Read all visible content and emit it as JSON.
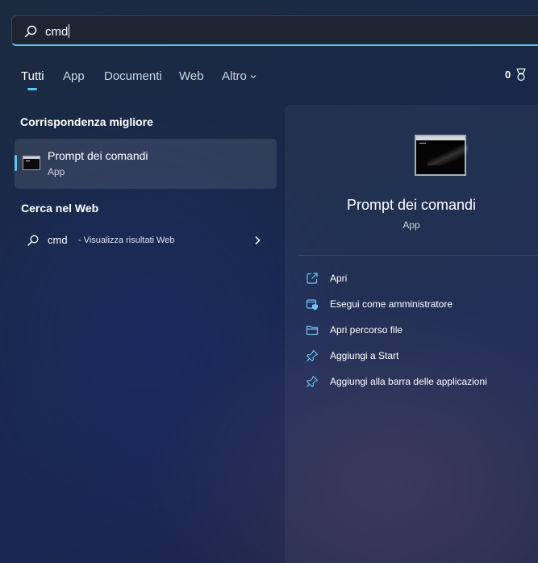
{
  "search": {
    "query": "cmd"
  },
  "tabs": [
    {
      "label": "Tutti",
      "active": true
    },
    {
      "label": "App",
      "active": false
    },
    {
      "label": "Documenti",
      "active": false
    },
    {
      "label": "Web",
      "active": false
    },
    {
      "label": "Altro",
      "active": false,
      "icon": "chevron-down-icon"
    }
  ],
  "rewards": {
    "points": "0",
    "icon": "medal-icon"
  },
  "best_match": {
    "section_title": "Corrispondenza migliore",
    "name": "Prompt dei comandi",
    "type": "App",
    "icon": "command-prompt-icon"
  },
  "web_search": {
    "section_title": "Cerca nel Web",
    "query": "cmd",
    "suffix": "- Visualizza risultati Web",
    "icon": "search-icon"
  },
  "preview": {
    "title": "Prompt dei comandi",
    "subtitle": "App",
    "actions": [
      {
        "label": "Apri",
        "icon": "open-external-icon"
      },
      {
        "label": "Esegui come amministratore",
        "icon": "admin-shield-icon"
      },
      {
        "label": "Apri percorso file",
        "icon": "folder-icon"
      },
      {
        "label": "Aggiungi a Start",
        "icon": "pin-icon"
      },
      {
        "label": "Aggiungi alla barra delle applicazioni",
        "icon": "pin-icon"
      }
    ]
  },
  "colors": {
    "accent": "#5cc4f2",
    "icon_blue": "#6fc3f2"
  }
}
